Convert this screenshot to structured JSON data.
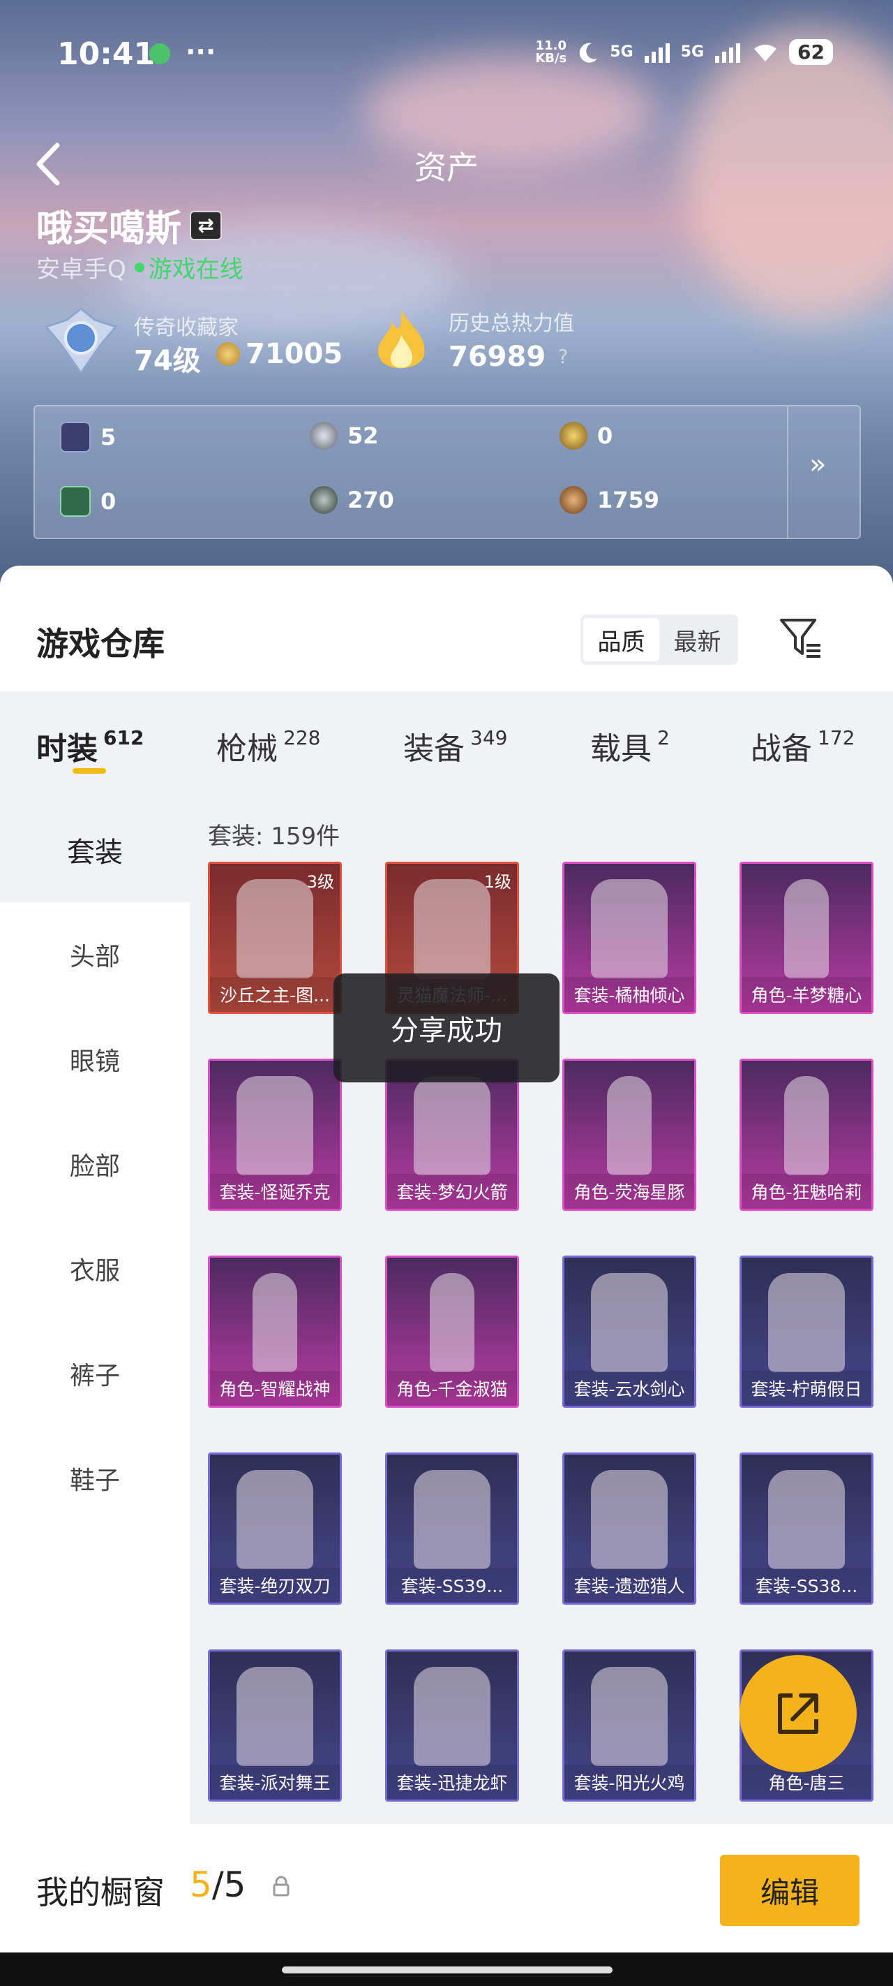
{
  "status_bar": {
    "time": "10:41",
    "more": "···",
    "net_speed_value": "11.0",
    "net_speed_unit": "KB/s",
    "sim1": "5G",
    "sim2": "5G",
    "battery": "62"
  },
  "header": {
    "title": "资产"
  },
  "profile": {
    "nickname": "哦买噶斯",
    "switch_icon": "⇄",
    "platform": "安卓手Q",
    "status": "游戏在线",
    "level_label": "传奇收藏家",
    "level_value": "74级",
    "coins": "71005",
    "heat_label": "历史总热力值",
    "heat_value": "76989",
    "help": "?"
  },
  "currencies": [
    {
      "icon": "card-icon",
      "value": "5"
    },
    {
      "icon": "silver-coin-icon",
      "value": "52"
    },
    {
      "icon": "gold-a-coin-icon",
      "value": "0"
    },
    {
      "icon": "green-card-icon",
      "value": "0"
    },
    {
      "icon": "dark-coin-icon",
      "value": "270"
    },
    {
      "icon": "bronze-coin-icon",
      "value": "1759"
    }
  ],
  "currency_more": "»",
  "warehouse": {
    "title": "游戏仓库",
    "sort_options": [
      "品质",
      "最新"
    ],
    "active_sort": "品质"
  },
  "tabs": [
    {
      "label": "时装",
      "count": "612"
    },
    {
      "label": "枪械",
      "count": "228"
    },
    {
      "label": "装备",
      "count": "349"
    },
    {
      "label": "载具",
      "count": "2"
    },
    {
      "label": "战备",
      "count": "172"
    }
  ],
  "side_categories": [
    "套装",
    "头部",
    "眼镜",
    "脸部",
    "衣服",
    "裤子",
    "鞋子"
  ],
  "content": {
    "count_label": "套装: 159件"
  },
  "items": [
    {
      "name": "沙丘之主-图...",
      "level": "3级",
      "tier": "red"
    },
    {
      "name": "灵猫魔法师-...",
      "level": "1级",
      "tier": "red"
    },
    {
      "name": "套装-橘柚倾心",
      "level": "",
      "tier": "purple"
    },
    {
      "name": "角色-羊梦糖心",
      "level": "",
      "tier": "purple"
    },
    {
      "name": "套装-怪诞乔克",
      "level": "",
      "tier": "purple"
    },
    {
      "name": "套装-梦幻火箭",
      "level": "",
      "tier": "purple"
    },
    {
      "name": "角色-荧海星豚",
      "level": "",
      "tier": "purple"
    },
    {
      "name": "角色-狂魅哈莉",
      "level": "",
      "tier": "purple"
    },
    {
      "name": "角色-智耀战神",
      "level": "",
      "tier": "purple"
    },
    {
      "name": "角色-千金淑猫",
      "level": "",
      "tier": "purple"
    },
    {
      "name": "套装-云水剑心",
      "level": "",
      "tier": "blue"
    },
    {
      "name": "套装-柠萌假日",
      "level": "",
      "tier": "blue"
    },
    {
      "name": "套装-绝刃双刀",
      "level": "",
      "tier": "blue"
    },
    {
      "name": "套装-SS39...",
      "level": "",
      "tier": "blue"
    },
    {
      "name": "套装-遗迹猎人",
      "level": "",
      "tier": "blue"
    },
    {
      "name": "套装-SS38...",
      "level": "",
      "tier": "blue"
    },
    {
      "name": "套装-派对舞王",
      "level": "",
      "tier": "blue"
    },
    {
      "name": "套装-迅捷龙虾",
      "level": "",
      "tier": "blue"
    },
    {
      "name": "套装-阳光火鸡",
      "level": "",
      "tier": "blue"
    },
    {
      "name": "角色-唐三",
      "level": "",
      "tier": "blue"
    }
  ],
  "toast": "分享成功",
  "showcase": {
    "label": "我的橱窗",
    "current": "5",
    "separator": "/",
    "max": "5",
    "edit_label": "编辑"
  },
  "colors": {
    "accent": "#f4b21b",
    "online": "#43d66b"
  }
}
